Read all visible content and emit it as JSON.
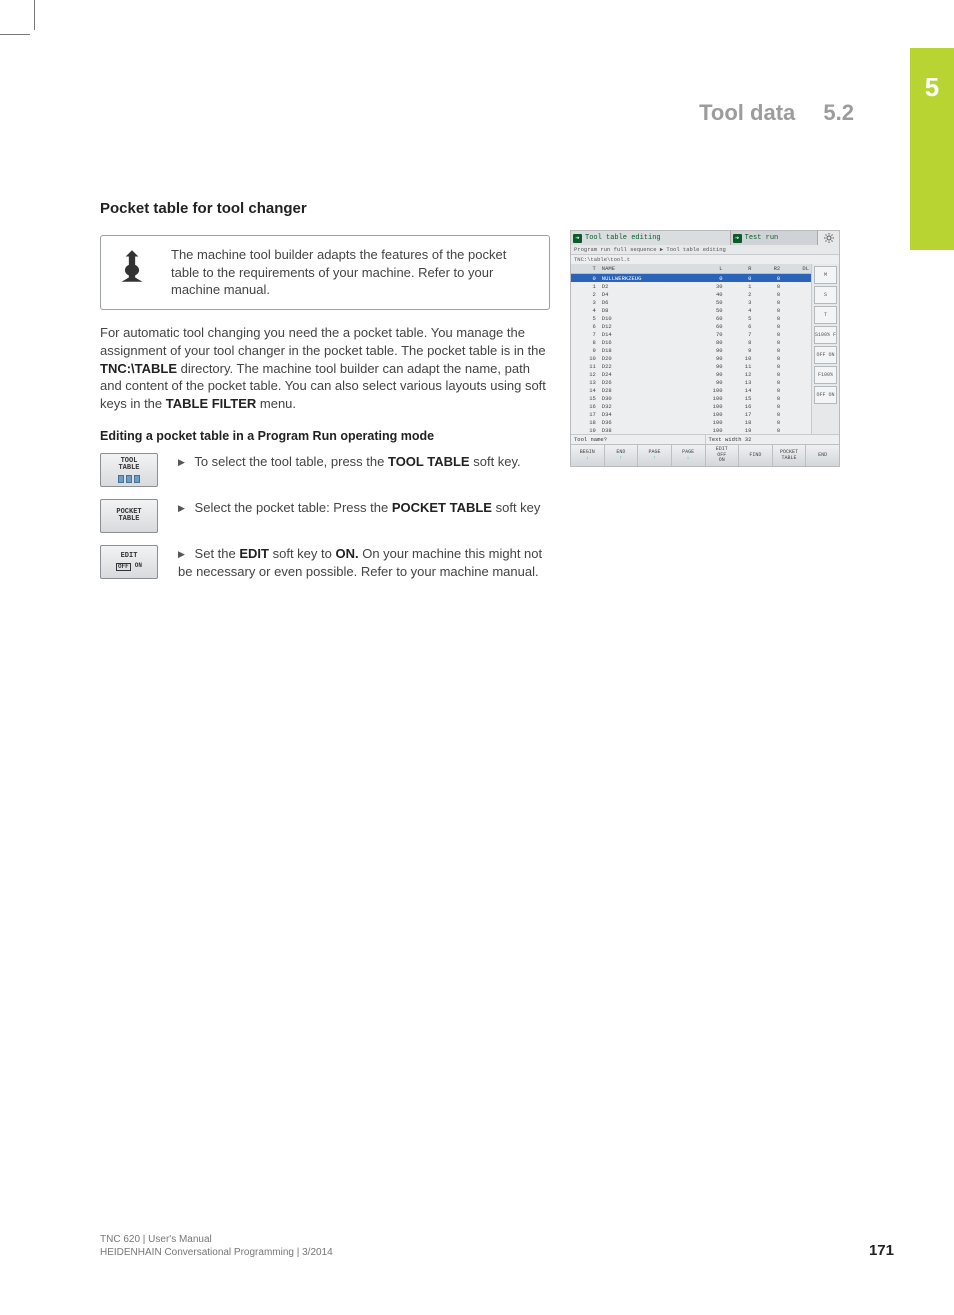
{
  "chapter_tab": "5",
  "header": {
    "title": "Tool data",
    "section": "5.2"
  },
  "subhead": "Pocket table for tool changer",
  "note": "The machine tool builder adapts the features of the pocket table to the requirements of your machine. Refer to your machine manual.",
  "para1_pre": "For automatic tool changing you need the a pocket table. You manage the assignment of your tool changer in the pocket table. The pocket table is in the ",
  "para1_bold1": "TNC:\\TABLE",
  "para1_mid": " directory. The machine tool builder can adapt the name, path and content of the pocket table. You can also select various layouts using soft keys in the ",
  "para1_bold2": "TABLE FILTER",
  "para1_post": " menu.",
  "minihead": "Editing a pocket table in a Program Run operating mode",
  "steps": [
    {
      "softkey": {
        "line1": "TOOL",
        "line2": "TABLE",
        "style": "icons"
      },
      "text_pre": "To select the tool table, press the ",
      "text_bold": "TOOL TABLE",
      "text_post": " soft key."
    },
    {
      "softkey": {
        "line1": "POCKET",
        "line2": "TABLE",
        "style": "plain"
      },
      "text_pre": "Select the pocket table: Press the ",
      "text_bold": "POCKET TABLE",
      "text_post": " soft key"
    },
    {
      "softkey": {
        "line1": "EDIT",
        "line2": "",
        "style": "offon"
      },
      "text_pre": "Set the ",
      "text_bold": "EDIT",
      "text_mid": " soft key to ",
      "text_bold2": "ON.",
      "text_post": " On your machine this might not be necessary or even possible. Refer to your machine manual."
    }
  ],
  "figure": {
    "title_left": "Tool table editing",
    "title_right": "Test run",
    "subbar": "Program run full sequence ▶ Tool table editing",
    "path": "TNC:\\table\\tool.t",
    "columns": [
      "T",
      "NAME",
      "L",
      "R",
      "R2",
      "DL"
    ],
    "rows": [
      {
        "t": "0",
        "name": "NULLWERKZEUG",
        "l": "0",
        "r": "0",
        "r2": "0",
        "dl": "",
        "selected": true
      },
      {
        "t": "1",
        "name": "D2",
        "l": "30",
        "r": "1",
        "r2": "0",
        "dl": ""
      },
      {
        "t": "2",
        "name": "D4",
        "l": "40",
        "r": "2",
        "r2": "0",
        "dl": ""
      },
      {
        "t": "3",
        "name": "D6",
        "l": "50",
        "r": "3",
        "r2": "0",
        "dl": ""
      },
      {
        "t": "4",
        "name": "D8",
        "l": "50",
        "r": "4",
        "r2": "0",
        "dl": ""
      },
      {
        "t": "5",
        "name": "D10",
        "l": "60",
        "r": "5",
        "r2": "0",
        "dl": ""
      },
      {
        "t": "6",
        "name": "D12",
        "l": "60",
        "r": "6",
        "r2": "0",
        "dl": ""
      },
      {
        "t": "7",
        "name": "D14",
        "l": "70",
        "r": "7",
        "r2": "0",
        "dl": ""
      },
      {
        "t": "8",
        "name": "D16",
        "l": "80",
        "r": "8",
        "r2": "0",
        "dl": ""
      },
      {
        "t": "9",
        "name": "D18",
        "l": "90",
        "r": "9",
        "r2": "0",
        "dl": ""
      },
      {
        "t": "10",
        "name": "D20",
        "l": "90",
        "r": "10",
        "r2": "0",
        "dl": ""
      },
      {
        "t": "11",
        "name": "D22",
        "l": "90",
        "r": "11",
        "r2": "0",
        "dl": ""
      },
      {
        "t": "12",
        "name": "D24",
        "l": "90",
        "r": "12",
        "r2": "0",
        "dl": ""
      },
      {
        "t": "13",
        "name": "D26",
        "l": "90",
        "r": "13",
        "r2": "0",
        "dl": ""
      },
      {
        "t": "14",
        "name": "D28",
        "l": "100",
        "r": "14",
        "r2": "0",
        "dl": ""
      },
      {
        "t": "15",
        "name": "D30",
        "l": "100",
        "r": "15",
        "r2": "0",
        "dl": ""
      },
      {
        "t": "16",
        "name": "D32",
        "l": "100",
        "r": "16",
        "r2": "0",
        "dl": ""
      },
      {
        "t": "17",
        "name": "D34",
        "l": "100",
        "r": "17",
        "r2": "0",
        "dl": ""
      },
      {
        "t": "18",
        "name": "D36",
        "l": "100",
        "r": "18",
        "r2": "0",
        "dl": ""
      },
      {
        "t": "19",
        "name": "D38",
        "l": "100",
        "r": "19",
        "r2": "0",
        "dl": ""
      }
    ],
    "status_left": "Tool name?",
    "status_mid": "Text width 32",
    "sidebar": [
      "M",
      "S",
      "T",
      "S100% F",
      "OFF  ON",
      "F100%",
      "OFF  ON"
    ],
    "softkeys": [
      "BEGIN",
      "END",
      "PAGE",
      "PAGE",
      "EDIT OFF ON",
      "FIND",
      "POCKET TABLE",
      "END"
    ]
  },
  "footer": {
    "line1": "TNC 620 | User's Manual",
    "line2": "HEIDENHAIN Conversational Programming | 3/2014",
    "page": "171"
  }
}
